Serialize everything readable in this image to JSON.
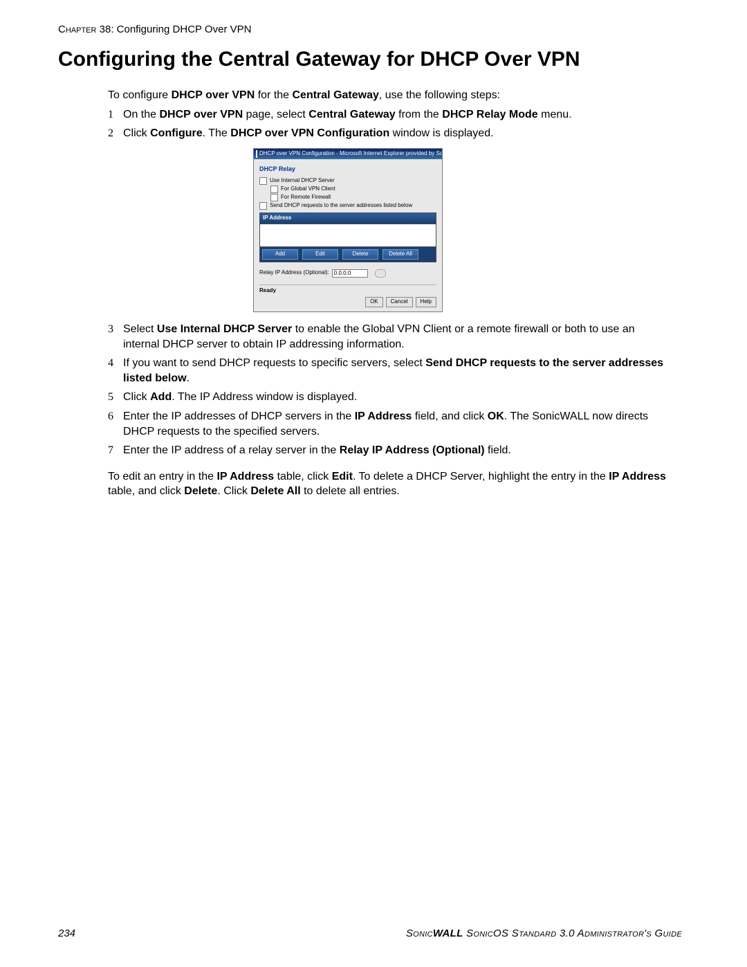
{
  "header": {
    "chapter_prefix": "Chapter",
    "chapter_num": "38",
    "chapter_title": "Configuring DHCP Over VPN"
  },
  "title": "Configuring the Central Gateway for DHCP Over VPN",
  "intro": {
    "pre": "To configure ",
    "b1": "DHCP over VPN",
    "mid": " for the ",
    "b2": "Central Gateway",
    "post": ", use the following steps:"
  },
  "step1": {
    "pre": "On the ",
    "b1": "DHCP over VPN",
    "mid1": " page, select ",
    "b2": "Central Gateway",
    "mid2": " from the ",
    "b3": "DHCP Relay Mode",
    "post": " menu."
  },
  "step2": {
    "pre": "Click ",
    "b1": "Configure",
    "mid": ". The ",
    "b2": "DHCP over VPN Configuration",
    "post": " window is displayed."
  },
  "step3": {
    "pre": "Select ",
    "b1": "Use Internal DHCP Server",
    "post": " to enable the Global VPN Client or a remote firewall or both to use an internal DHCP server to obtain IP addressing information."
  },
  "step4": {
    "pre": "If you want to send DHCP requests to specific servers, select ",
    "b1": "Send DHCP requests to the server addresses listed below",
    "post": "."
  },
  "step5": {
    "pre": "Click ",
    "b1": "Add",
    "post": ". The IP Address window is displayed."
  },
  "step6": {
    "pre": "Enter the IP addresses of DHCP servers in the ",
    "b1": "IP Address",
    "mid": " field, and click ",
    "b2": "OK",
    "post": ". The SonicWALL now directs DHCP requests to the specified servers."
  },
  "step7": {
    "pre": "Enter the IP address of a relay server in the ",
    "b1": "Relay IP Address (Optional)",
    "post": " field."
  },
  "tail": {
    "pre": "To edit an entry in the ",
    "b1": "IP Address",
    "mid1": " table, click ",
    "b2": "Edit",
    "mid2": ". To delete a DHCP Server, highlight the entry in the ",
    "b3": "IP Address",
    "mid3": " table, and click ",
    "b4": "Delete",
    "mid4": ". Click ",
    "b5": "Delete All",
    "post": " to delete all entries."
  },
  "screenshot": {
    "window_title": "DHCP over VPN Configuration - Microsoft Internet Explorer provided by Son...",
    "section": "DHCP Relay",
    "chk_use_internal": "Use Internal DHCP Server",
    "chk_global_vpn": "For Global VPN Client",
    "chk_remote_fw": "For Remote Firewall",
    "chk_send_dhcp": "Send DHCP requests to the server addresses listed below",
    "ip_header": "IP Address",
    "btn_add": "Add",
    "btn_edit": "Edit",
    "btn_delete": "Delete",
    "btn_delete_all": "Delete All",
    "relay_label": "Relay IP Address (Optional):",
    "relay_value": "0.0.0.0",
    "status": "Ready",
    "ok": "OK",
    "cancel": "Cancel",
    "help": "Help"
  },
  "footer": {
    "pageno": "234",
    "brand_prefix": "Sonic",
    "brand_bold": "WALL",
    "guide_rest": " SonicOS Standard 3.0 Administrator's Guide"
  }
}
